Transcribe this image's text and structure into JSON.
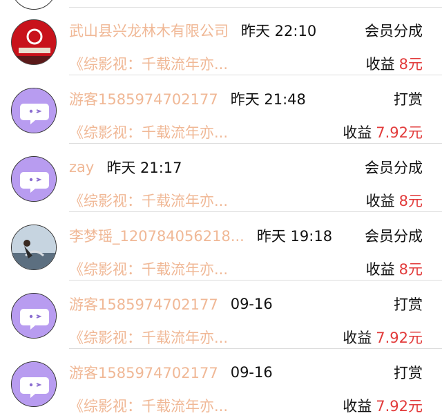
{
  "rows": [
    {
      "name": "武山县兴龙林木有限公司",
      "time": "昨天 22:10",
      "type": "会员分成",
      "work": "《综影视：千载流年亦...",
      "income_label": "收益",
      "amount": "8元",
      "avatar": "photo-red"
    },
    {
      "name": "游客1585974702177",
      "time": "昨天 21:48",
      "type": "打赏",
      "work": "《综影视：千载流年亦...",
      "income_label": "收益",
      "amount": "7.92元",
      "avatar": "default-chat"
    },
    {
      "name": "zay",
      "time": "昨天 21:17",
      "type": "会员分成",
      "work": "《综影视：千载流年亦...",
      "income_label": "收益",
      "amount": "8元",
      "avatar": "default-chat"
    },
    {
      "name": "李梦瑶_120784056218...",
      "time": "昨天 19:18",
      "type": "会员分成",
      "work": "《综影视：千载流年亦...",
      "income_label": "收益",
      "amount": "8元",
      "avatar": "photo-sky"
    },
    {
      "name": "游客1585974702177",
      "time": "09-16",
      "type": "打赏",
      "work": "《综影视：千载流年亦...",
      "income_label": "收益",
      "amount": "7.92元",
      "avatar": "default-chat"
    },
    {
      "name": "游客1585974702177",
      "time": "09-16",
      "type": "打赏",
      "work": "《综影视：千载流年亦...",
      "income_label": "收益",
      "amount": "7.92元",
      "avatar": "default-chat"
    }
  ],
  "colors": {
    "name": "#f0b896",
    "amount": "#e23b3b",
    "avatar_bg": "#b89cf0"
  }
}
